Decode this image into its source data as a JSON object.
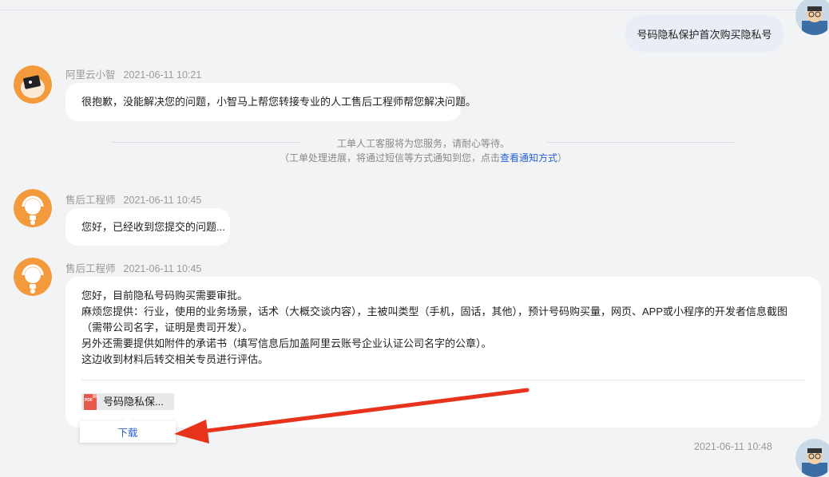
{
  "user_message": {
    "text": "号码隐私保护首次购买隐私号"
  },
  "messages": [
    {
      "sender": "阿里云小智",
      "time": "2021-06-11 10:21",
      "text": "很抱歉，没能解决您的问题，小智马上帮您转接专业的人工售后工程师帮您解决问题。"
    },
    {
      "sender": "售后工程师",
      "time": "2021-06-11 10:45",
      "text": "您好，已经收到您提交的问题..."
    },
    {
      "sender": "售后工程师",
      "time": "2021-06-11 10:45",
      "lines": [
        "您好，目前隐私号码购买需要审批。",
        "麻烦您提供：行业，使用的业务场景，话术（大概交谈内容），主被叫类型（手机，固话，其他），预计号码购买量，网页、APP或小程序的开发者信息截图（需带公司名字，证明是贵司开发）。",
        "另外还需要提供如附件的承诺书（填写信息后加盖阿里云账号企业认证公司名字的公章）。",
        "这边收到材料后转交相关专员进行评估。"
      ],
      "attachment": {
        "icon": "pdf-icon",
        "icon_label": "PDF",
        "name": "号码隐私保..."
      }
    }
  ],
  "system_notice": {
    "line1": "工单人工客服将为您服务，请耐心等待。",
    "line2_prefix": "（工单处理进展，将通过短信等方式通知到您，点击",
    "line2_link": "查看通知方式",
    "line2_suffix": "）"
  },
  "download_popup": {
    "label": "下载"
  },
  "bottom_timestamp": "2021-06-11 10:48",
  "colors": {
    "accent": "#2a62d8",
    "arrow": "#e8331c",
    "agent_avatar": "#f39a3c",
    "page_bg": "#f2f3f5"
  }
}
